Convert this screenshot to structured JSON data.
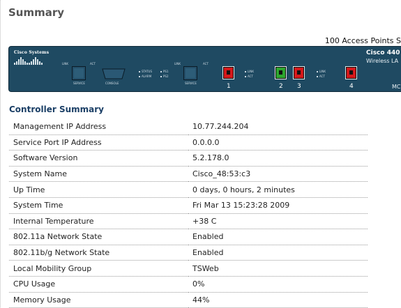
{
  "page": {
    "title": "Summary"
  },
  "device_panel": {
    "capacity_text": "100 Access Points S",
    "brand": "Cisco Systems",
    "model": "Cisco 440",
    "model_sub": "Wireless LA",
    "model_tail": "MC",
    "labels": {
      "link": "LINK",
      "act": "ACT",
      "service": "SERVICE",
      "console": "CONSOLE",
      "status": "STATUS",
      "alarm": "ALARM",
      "ps1": "PS1",
      "ps2": "PS2"
    },
    "ports": [
      {
        "number": "1",
        "state": "red"
      },
      {
        "number": "2",
        "state": "green"
      },
      {
        "number": "3",
        "state": "red"
      },
      {
        "number": "4",
        "state": "red"
      }
    ]
  },
  "controller_summary": {
    "title": "Controller Summary",
    "rows": [
      {
        "label": "Management IP Address",
        "value": "10.77.244.204"
      },
      {
        "label": "Service Port IP Address",
        "value": "0.0.0.0"
      },
      {
        "label": "Software Version",
        "value": "5.2.178.0"
      },
      {
        "label": "System Name",
        "value": "Cisco_48:53:c3"
      },
      {
        "label": "Up Time",
        "value": "0 days, 0 hours, 2 minutes"
      },
      {
        "label": "System Time",
        "value": "Fri Mar 13 15:23:28 2009"
      },
      {
        "label": "Internal Temperature",
        "value": "+38 C"
      },
      {
        "label": "802.11a Network State",
        "value": "Enabled"
      },
      {
        "label": "802.11b/g Network State",
        "value": "Enabled"
      },
      {
        "label": "Local Mobility Group",
        "value": "TSWeb"
      },
      {
        "label": "CPU Usage",
        "value": "0%"
      },
      {
        "label": "Memory Usage",
        "value": "44%"
      }
    ]
  },
  "colors": {
    "panel": "#1f4a62",
    "section_title": "#1b3f66",
    "port_red": "#d6181a",
    "port_green": "#2ea62e"
  }
}
